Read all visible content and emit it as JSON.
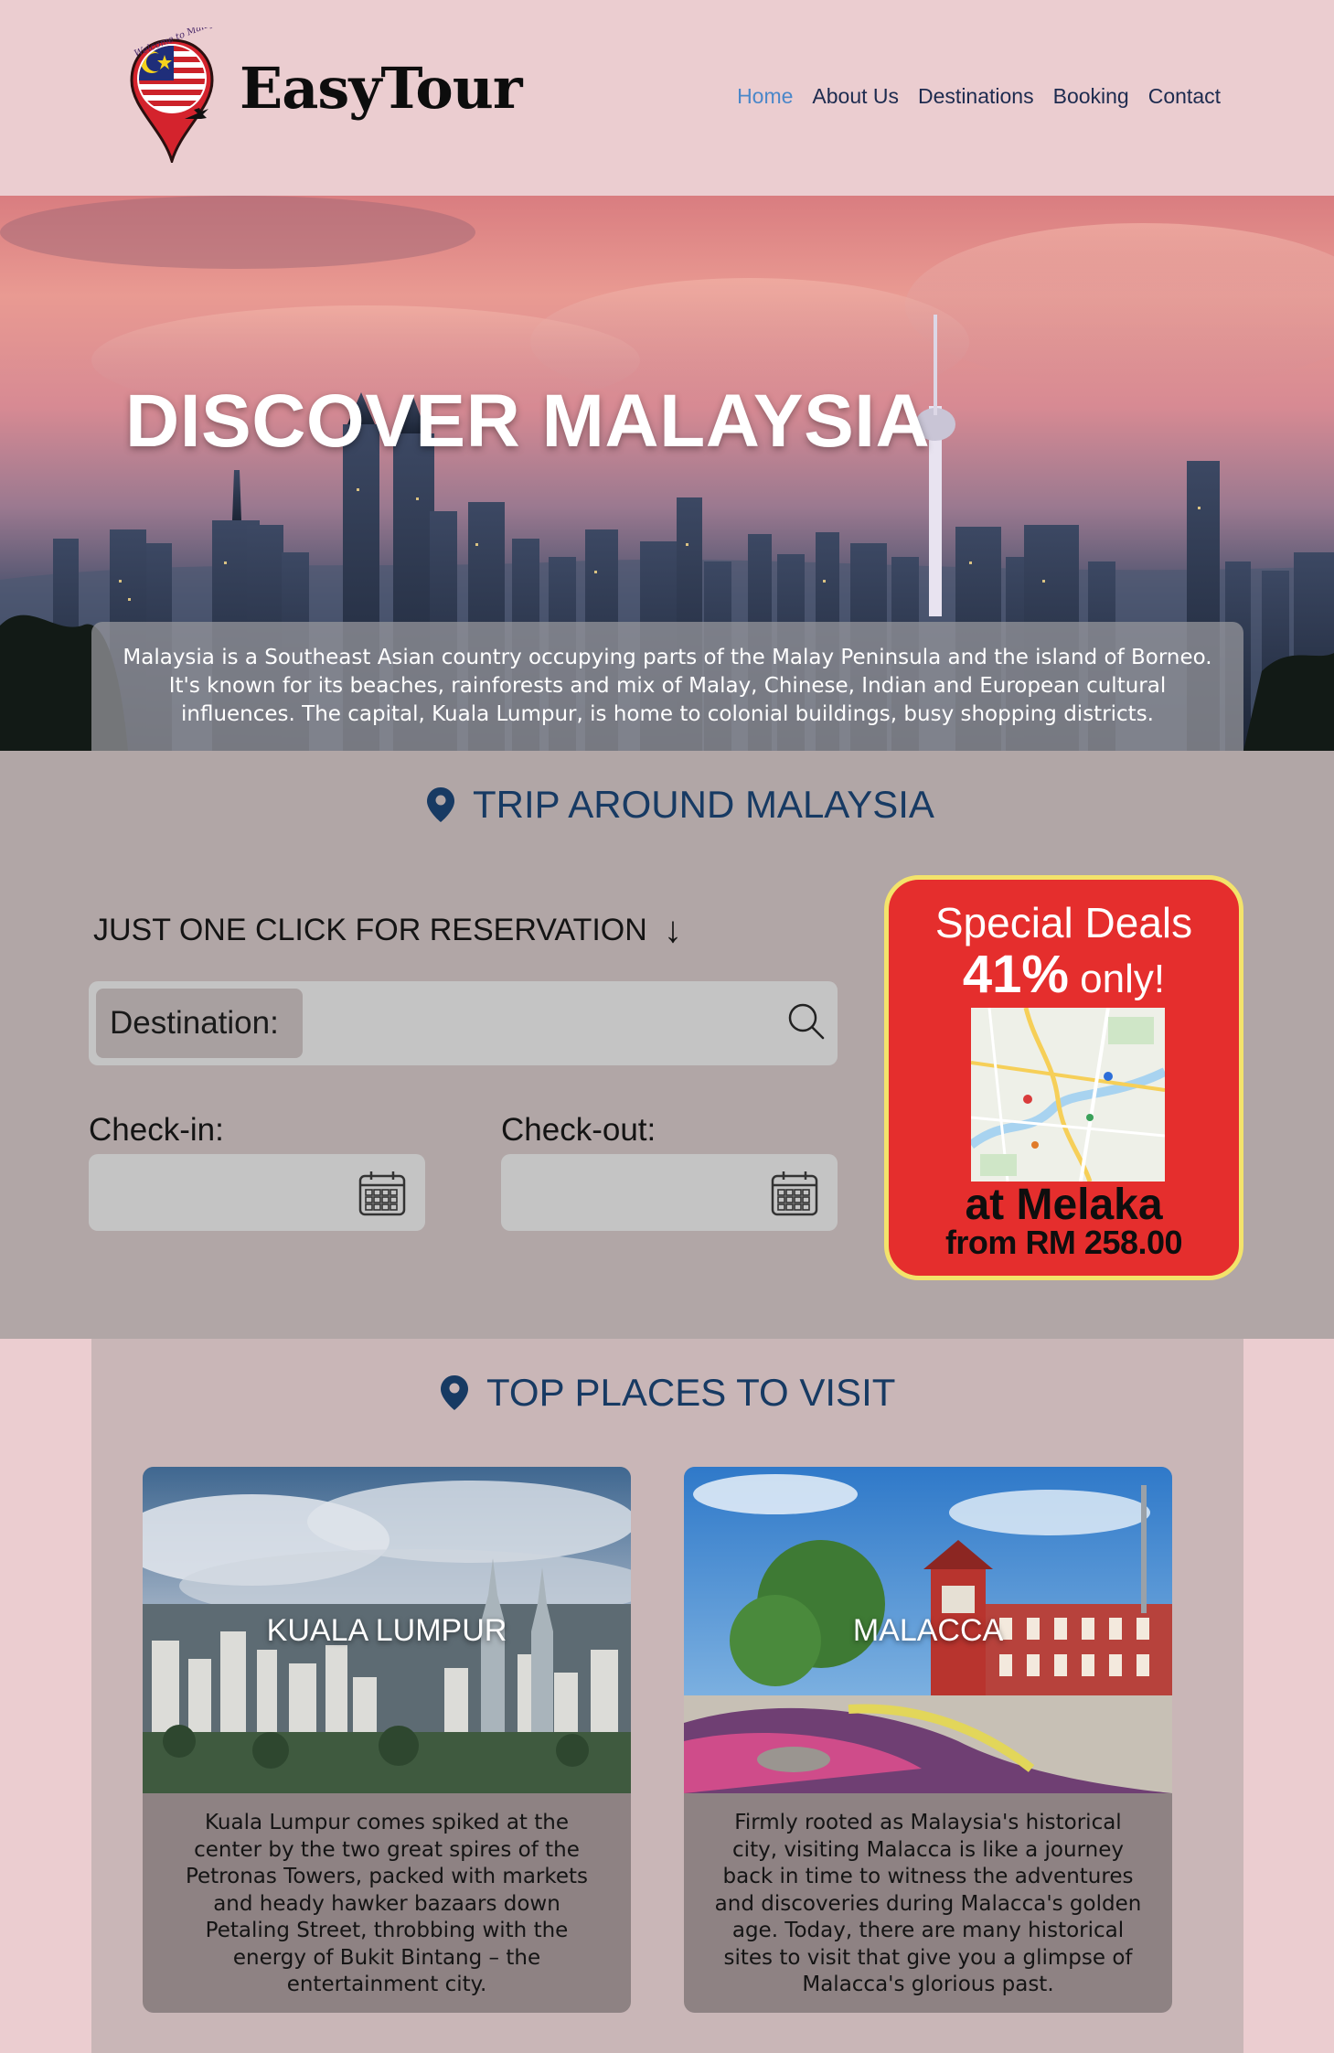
{
  "brand": {
    "name": "EasyTour",
    "logo_text": "Welcome to Malaysia"
  },
  "nav": {
    "items": [
      {
        "label": "Home",
        "active": true
      },
      {
        "label": "About Us",
        "active": false
      },
      {
        "label": "Destinations",
        "active": false
      },
      {
        "label": "Booking",
        "active": false
      },
      {
        "label": "Contact",
        "active": false
      }
    ]
  },
  "hero": {
    "title": "DISCOVER MALAYSIA",
    "description": "Malaysia is a Southeast Asian country occupying parts of the Malay Peninsula and the island of Borneo. It's known for its beaches, rainforests and mix of Malay, Chinese, Indian and European cultural influences. The capital, Kuala Lumpur, is home to colonial buildings, busy shopping districts."
  },
  "trip": {
    "title": "TRIP AROUND MALAYSIA",
    "reservation_label": "JUST ONE CLICK FOR RESERVATION",
    "reservation_arrow": "↓",
    "destination_label": "Destination:",
    "destination_value": "",
    "checkin_label": "Check-in:",
    "checkout_label": "Check-out:",
    "checkin_value": "",
    "checkout_value": ""
  },
  "deal": {
    "title": "Special Deals",
    "percent": "41%",
    "percent_suffix": " only!",
    "place": "at Melaka",
    "price": "from RM 258.00",
    "border_color": "#f3e36b",
    "bg_color": "#e52e2d"
  },
  "places": {
    "title": "TOP PLACES TO VISIT",
    "cards": [
      {
        "name": "KUALA LUMPUR",
        "description": "Kuala Lumpur comes spiked at the center by the two great spires of the Petronas Towers, packed with markets and heady hawker bazaars down Petaling Street, throbbing with the energy of Bukit Bintang – the entertainment city."
      },
      {
        "name": "MALACCA",
        "description": "Firmly rooted as Malaysia's historical city, visiting Malacca is like a journey back in time to witness the adventures and discoveries during Malacca's golden age. Today, there are many historical sites to visit that give you a glimpse of Malacca's glorious past."
      }
    ]
  },
  "colors": {
    "page_bg": "#ebcdd0",
    "heading": "#173a63",
    "nav_active": "#4a87c9",
    "nav": "#1d2b4f",
    "trip_bg": "#b1a6a6",
    "places_bg": "#c9b6b7"
  }
}
